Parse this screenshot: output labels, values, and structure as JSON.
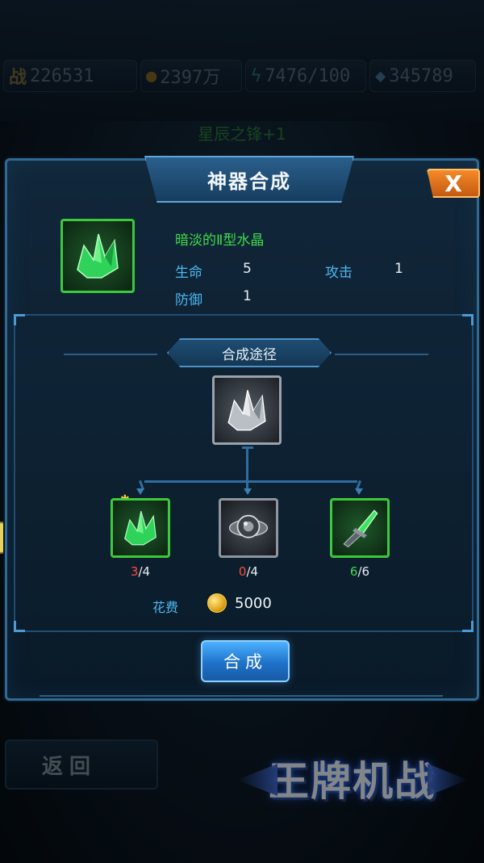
{
  "topbar": {
    "power_icon": "战",
    "power": "226531",
    "gold": "2397万",
    "energy": "7476/100",
    "gems": "345789"
  },
  "background_item_title": "星辰之锋+1",
  "dialog": {
    "title": "神器合成",
    "close_label": "X",
    "item": {
      "name": "暗淡的Ⅱ型水晶",
      "stats": [
        {
          "label": "生命",
          "value": "5"
        },
        {
          "label": "攻击",
          "value": "1"
        },
        {
          "label": "防御",
          "value": "1"
        }
      ]
    },
    "recipe": {
      "title": "合成途径",
      "ingredients": [
        {
          "have": "3",
          "need": "4",
          "frame": "green",
          "icon": "green-crystal-icon"
        },
        {
          "have": "0",
          "need": "4",
          "frame": "gray",
          "icon": "metal-orb-icon"
        },
        {
          "have": "6",
          "need": "6",
          "frame": "green",
          "icon": "green-blade-icon"
        }
      ],
      "cost_label": "花费",
      "cost_value": "5000"
    },
    "craft_label": "合成"
  },
  "bottom": {
    "back_label": "返回",
    "logo_text": "王牌机战"
  },
  "colors": {
    "accent_blue": "#4bb8f2",
    "item_green": "#3fdc4a",
    "warn_red": "#ff4b3a",
    "close_orange": "#f58a2a"
  }
}
